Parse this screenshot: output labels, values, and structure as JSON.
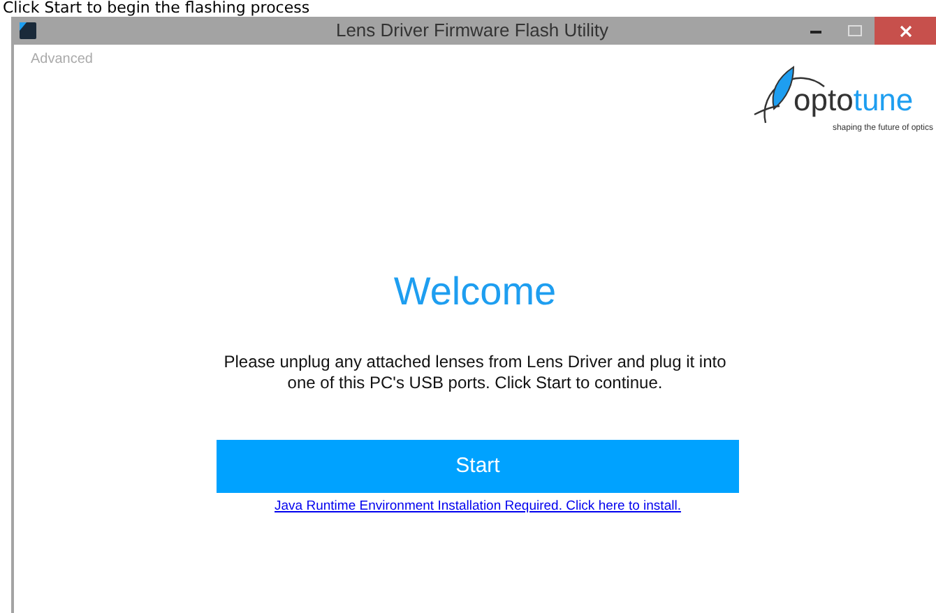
{
  "caption": "Click Start to begin the flashing process",
  "window": {
    "title": "Lens Driver Firmware Flash Utility"
  },
  "menu": {
    "label": "Advanced"
  },
  "logo": {
    "name_part_1": "opto",
    "name_part_2": "tune",
    "tagline": "shaping the future of optics"
  },
  "heading": "Welcome",
  "message": "Please unplug any attached lenses from Lens Driver and plug it into one of this PC's USB ports. Click Start to continue.",
  "start_button": {
    "label": "Start"
  },
  "install_link": "Java Runtime Environment Installation Required. Click here to install."
}
